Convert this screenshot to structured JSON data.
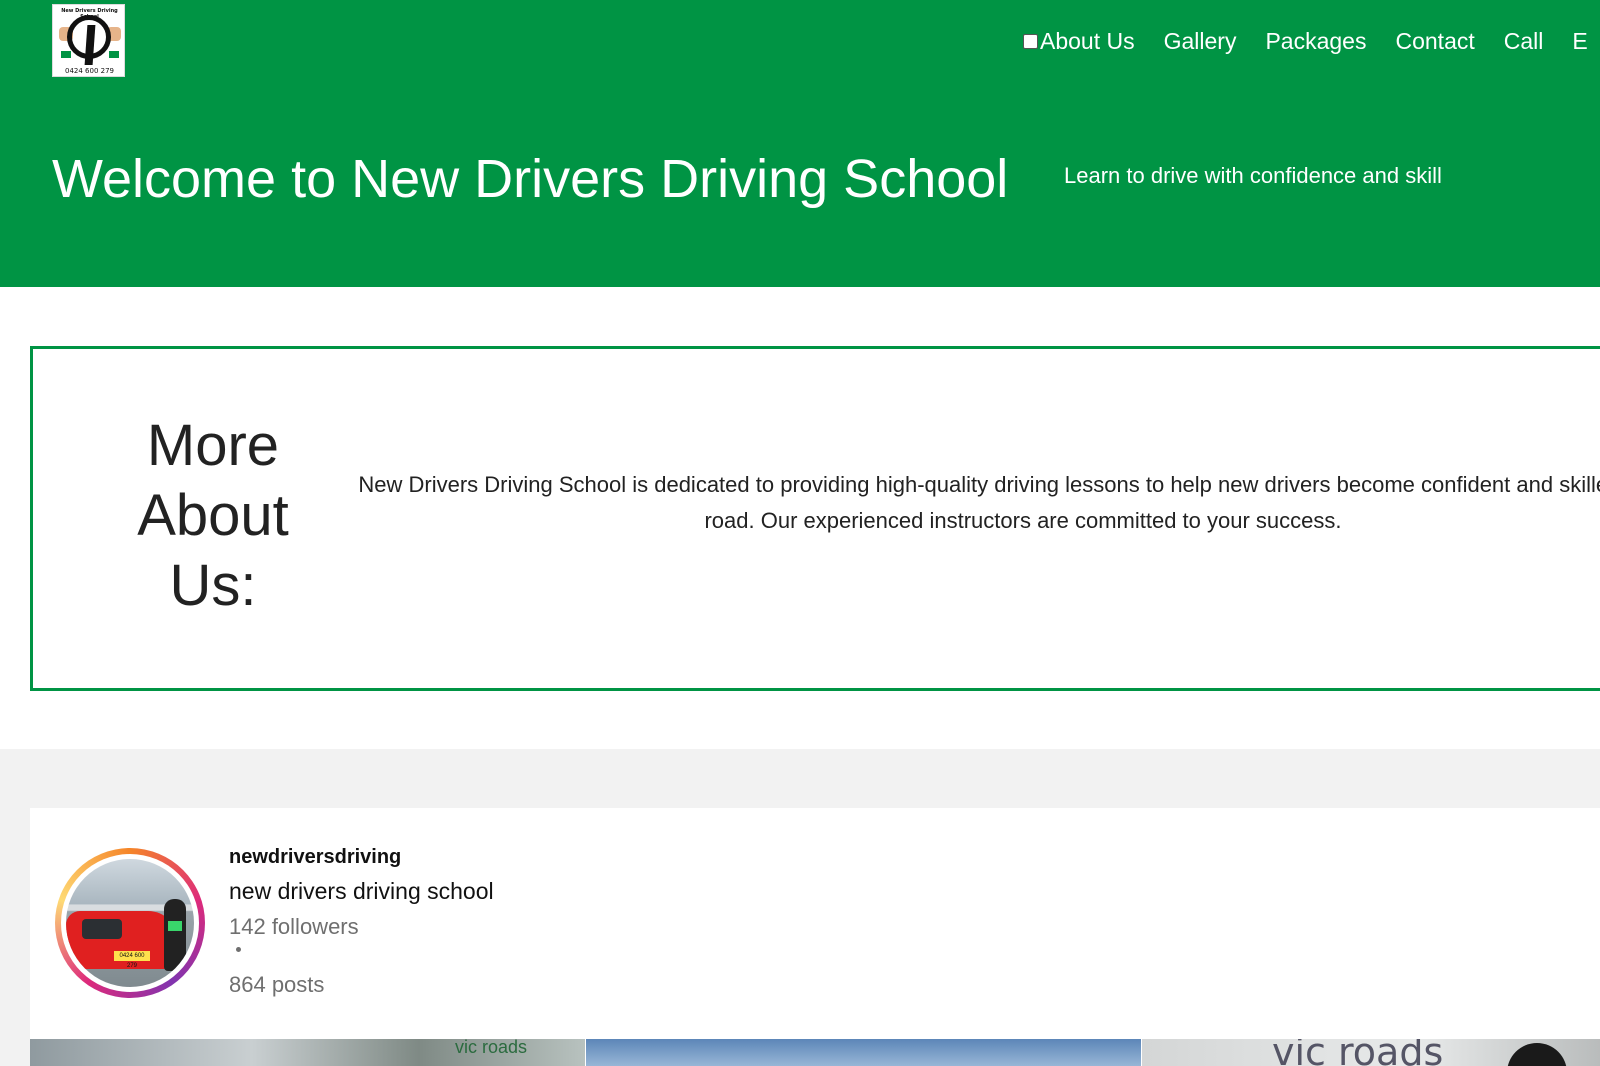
{
  "header": {
    "logo": {
      "top_text": "New Drivers Driving School",
      "phone": "0424 600 279",
      "icon": "steering-road-logo"
    },
    "nav": {
      "items": [
        "About Us",
        "Gallery",
        "Packages",
        "Contact",
        "Call",
        "E"
      ]
    },
    "title": "Welcome to New Drivers Driving School",
    "subtitle": "Learn to drive with confidence and skill"
  },
  "about": {
    "heading": "More About Us:",
    "text": "New Drivers Driving School is dedicated to providing high-quality driving lessons to help new drivers become confident and skilled on the road. Our experienced instructors are committed to your success."
  },
  "instagram": {
    "username": "newdriversdriving",
    "name": "new drivers driving school",
    "followers": "142 followers",
    "posts": "864 posts",
    "avatar": {
      "plate": "0424 600 279"
    },
    "thumbnails": [
      {
        "caption": "vic roads"
      },
      {
        "caption": ""
      },
      {
        "caption": "vic roads"
      }
    ]
  },
  "colors": {
    "brand_green": "#009444",
    "section_gray": "#f2f2f2",
    "text_dark": "#222222",
    "text_muted": "#6f6f6f"
  }
}
